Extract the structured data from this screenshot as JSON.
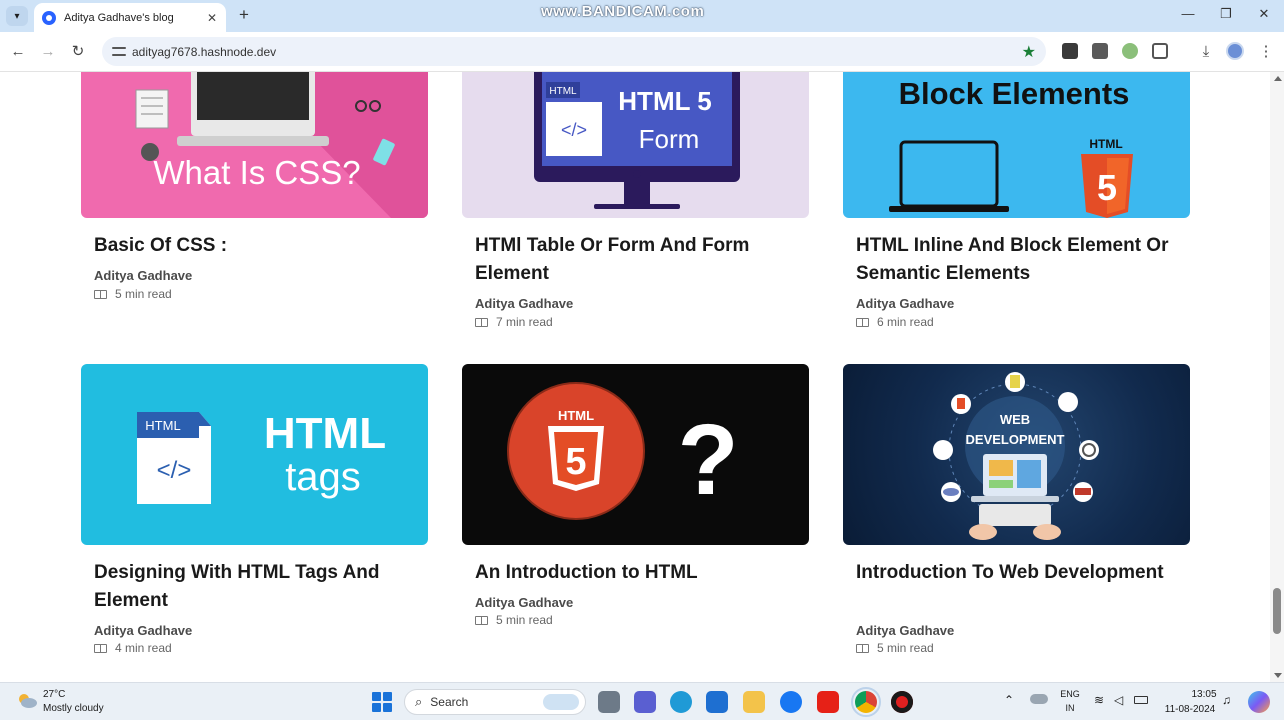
{
  "browser": {
    "tab_title": "Aditya Gadhave's blog",
    "url": "adityag7678.hashnode.dev",
    "watermark": "www.BANDICAM.com",
    "icons": [
      "tab-list-icon",
      "close-icon",
      "plus-icon",
      "back-icon",
      "forward-icon",
      "reload-icon",
      "site-info-icon",
      "bookmark-star-icon",
      "extensions-icon",
      "download-icon",
      "profile-avatar",
      "more-menu-icon",
      "minimize-icon",
      "maximize-icon",
      "window-close-icon"
    ]
  },
  "articles": [
    {
      "title": "Basic Of CSS :",
      "author": "Aditya Gadhave",
      "read_time": "5 min read",
      "thumb_text": "What Is CSS?"
    },
    {
      "title": "HTMl Table Or Form And Form Element",
      "author": "Aditya Gadhave",
      "read_time": "7 min read",
      "thumb_badge": "HTML",
      "thumb_heading": "HTML 5",
      "thumb_sub": "Form",
      "thumb_code": "</>"
    },
    {
      "title": "HTML Inline And Block Element Or Semantic Elements",
      "author": "Aditya Gadhave",
      "read_time": "6 min read",
      "thumb_heading": "Block Elements",
      "thumb_badge": "HTML",
      "thumb_five": "5"
    },
    {
      "title": "Designing With HTML Tags And Element",
      "author": "Aditya Gadhave",
      "read_time": "4 min read",
      "thumb_badge": "HTML",
      "thumb_code": "</>",
      "thumb_heading": "HTML",
      "thumb_sub": "tags"
    },
    {
      "title": "An Introduction to HTML",
      "author": "Aditya Gadhave",
      "read_time": "5 min read",
      "thumb_badge": "HTML",
      "thumb_five": "5",
      "thumb_mark": "?"
    },
    {
      "title": "Introduction To Web Development",
      "author": "Aditya Gadhave",
      "read_time": "5 min read",
      "thumb_line1": "WEB",
      "thumb_line2": "DEVELOPMENT"
    }
  ],
  "taskbar": {
    "weather_temp": "27°C",
    "weather_desc": "Mostly cloudy",
    "search_label": "Search",
    "lang_top": "ENG",
    "lang_bottom": "IN",
    "time": "13:05",
    "date": "11-08-2024"
  },
  "colors": {
    "accent": "#2962ff",
    "css_thumb": "#f06aae",
    "block_thumb": "#3cb8ef",
    "tags_thumb": "#21bde0",
    "html5_orange": "#e44d26"
  }
}
